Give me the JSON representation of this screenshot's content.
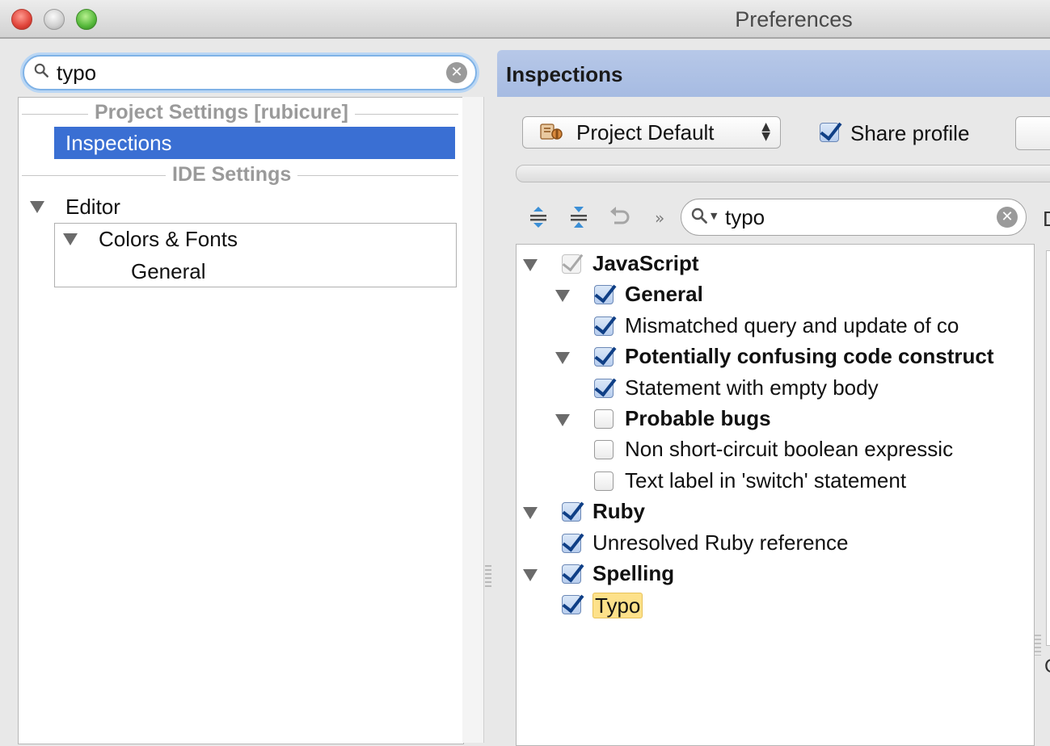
{
  "window": {
    "title": "Preferences"
  },
  "left": {
    "search": {
      "value": "typo"
    },
    "sections": {
      "project": "Project Settings [rubicure]",
      "ide": "IDE Settings"
    },
    "items": {
      "inspections": "Inspections",
      "editor": "Editor",
      "colors_fonts": "Colors & Fonts",
      "general": "General"
    }
  },
  "right": {
    "header": "Inspections",
    "profile": {
      "selected": "Project Default"
    },
    "share_profile": {
      "label": "Share profile",
      "checked": true
    },
    "search": {
      "value": "typo"
    },
    "edge_label": "D",
    "bottom_label": "C",
    "tree": [
      {
        "id": "javascript",
        "label": "JavaScript",
        "bold": true,
        "level": 0,
        "expandable": true,
        "state": "partial"
      },
      {
        "id": "js-general",
        "label": "General",
        "bold": true,
        "level": 1,
        "expandable": true,
        "state": "checked"
      },
      {
        "id": "mismatched",
        "label": "Mismatched query and update of co",
        "bold": false,
        "level": 2,
        "expandable": false,
        "state": "checked"
      },
      {
        "id": "confusing",
        "label": "Potentially confusing code construct",
        "bold": true,
        "level": 1,
        "expandable": true,
        "state": "checked"
      },
      {
        "id": "empty-body",
        "label": "Statement with empty body",
        "bold": false,
        "level": 2,
        "expandable": false,
        "state": "checked"
      },
      {
        "id": "probable-bugs",
        "label": "Probable bugs",
        "bold": true,
        "level": 1,
        "expandable": true,
        "state": "unchecked"
      },
      {
        "id": "non-short-circuit",
        "label": "Non short-circuit boolean expressic",
        "bold": false,
        "level": 2,
        "expandable": false,
        "state": "unchecked"
      },
      {
        "id": "text-label",
        "label": "Text label in 'switch' statement",
        "bold": false,
        "level": 2,
        "expandable": false,
        "state": "unchecked"
      },
      {
        "id": "ruby",
        "label": "Ruby",
        "bold": true,
        "level": 0,
        "expandable": true,
        "state": "checked"
      },
      {
        "id": "unresolved-ruby",
        "label": "Unresolved Ruby reference",
        "bold": false,
        "level": 1,
        "expandable": false,
        "state": "checked"
      },
      {
        "id": "spelling",
        "label": "Spelling",
        "bold": true,
        "level": 0,
        "expandable": true,
        "state": "checked"
      },
      {
        "id": "typo",
        "label": "Typo",
        "bold": false,
        "level": 1,
        "expandable": false,
        "state": "checked",
        "highlight": true
      }
    ]
  },
  "colors": {
    "selection": "#3a6fd3",
    "header": "#a6bbe2",
    "highlight": "#fde18a",
    "check": "#0f3f86"
  },
  "icons": [
    "search-icon",
    "clear-icon",
    "expand-all-icon",
    "collapse-all-icon",
    "reset-icon",
    "chevron-right-double-icon",
    "profile-icon",
    "updown-arrows-icon",
    "expand-triangle-icon"
  ]
}
